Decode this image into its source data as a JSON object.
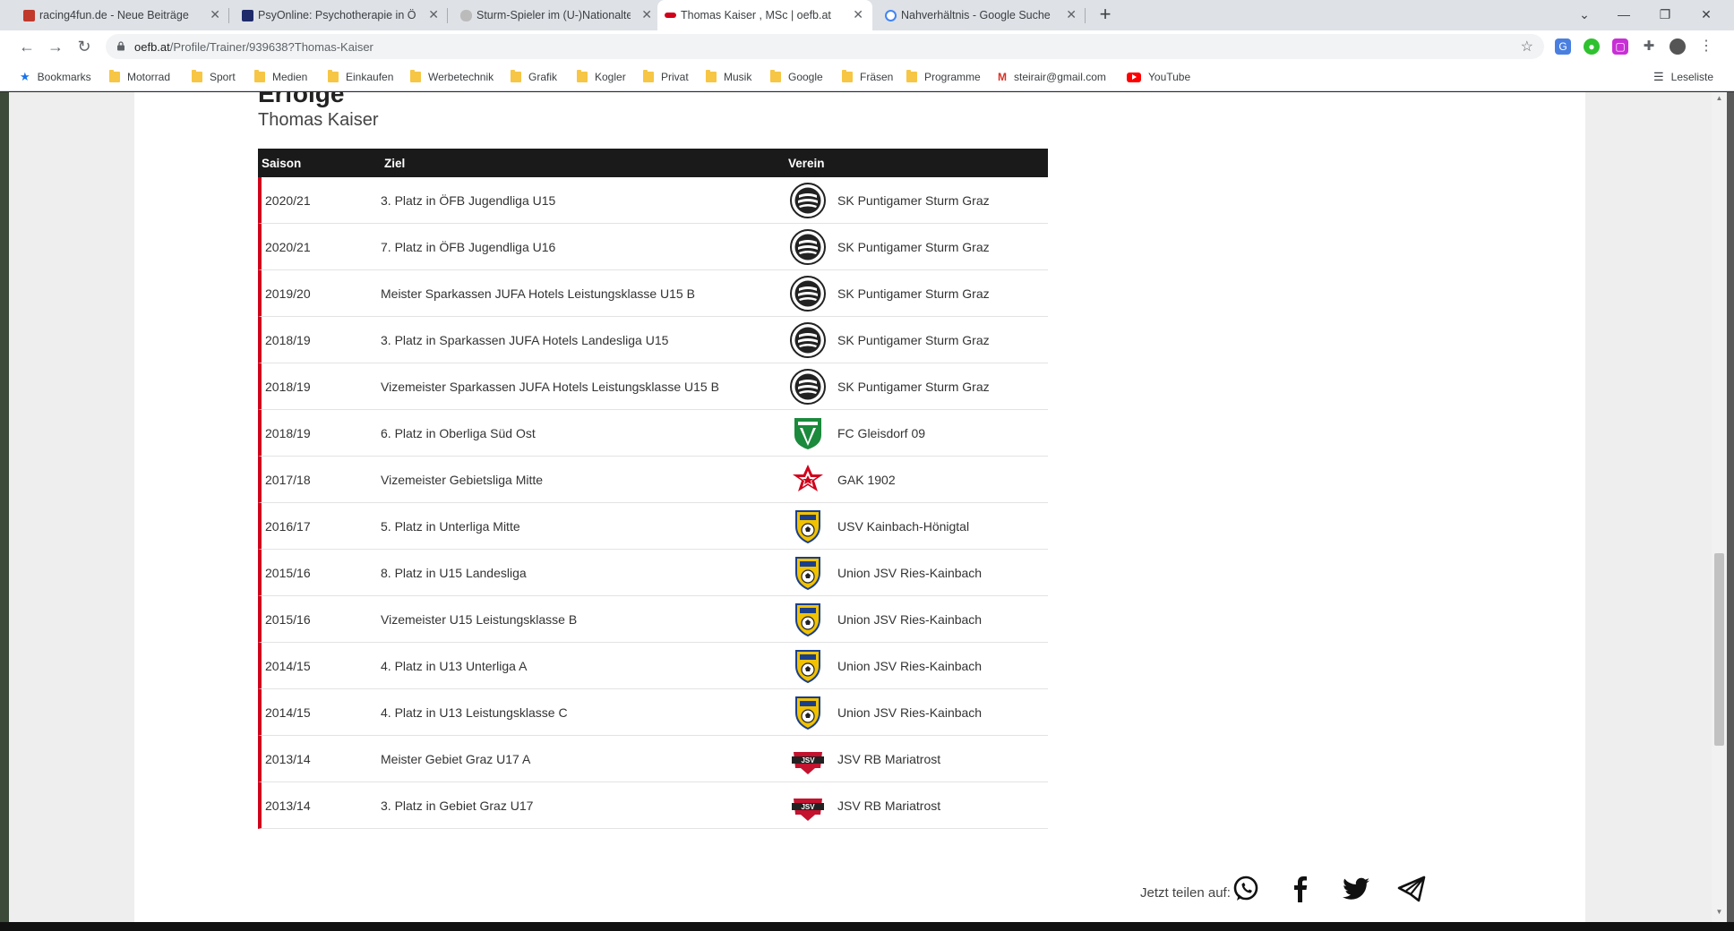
{
  "tabs": [
    {
      "label": "racing4fun.de - Neue Beiträge",
      "fav_color": "#c0392b"
    },
    {
      "label": "PsyOnline: Psychotherapie in Ö",
      "fav_color": "#1f2a6b"
    },
    {
      "label": "Sturm-Spieler im (U-)Nationaltea",
      "fav_color": "#8a8a8a"
    },
    {
      "label": "Thomas Kaiser , MSc | oefb.at",
      "fav_color": "#d0021b"
    },
    {
      "label": "Nahverhältnis - Google Suche",
      "fav_color": "#4285f4"
    }
  ],
  "address": {
    "host": "oefb.at",
    "path": "/Profile/Trainer/939638?Thomas-Kaiser"
  },
  "bookmarks": [
    {
      "label": "Bookmarks"
    },
    {
      "label": "Motorrad"
    },
    {
      "label": "Sport"
    },
    {
      "label": "Medien"
    },
    {
      "label": "Einkaufen"
    },
    {
      "label": "Werbetechnik"
    },
    {
      "label": "Grafik"
    },
    {
      "label": "Kogler"
    },
    {
      "label": "Privat"
    },
    {
      "label": "Musik"
    },
    {
      "label": "Google"
    },
    {
      "label": "Fräsen"
    },
    {
      "label": "Programme"
    },
    {
      "label": "steirair@gmail.com"
    },
    {
      "label": "YouTube"
    }
  ],
  "reading_list": "Leseliste",
  "page": {
    "heading": "Erfolge",
    "subheading": "Thomas Kaiser",
    "columns": {
      "season": "Saison",
      "goal": "Ziel",
      "club": "Verein"
    },
    "rows": [
      {
        "season": "2020/21",
        "goal": "3. Platz in ÖFB Jugendliga U15",
        "club": "SK Puntigamer Sturm Graz",
        "logo": "sturm"
      },
      {
        "season": "2020/21",
        "goal": "7. Platz in ÖFB Jugendliga U16",
        "club": "SK Puntigamer Sturm Graz",
        "logo": "sturm"
      },
      {
        "season": "2019/20",
        "goal": "Meister Sparkassen JUFA Hotels Leistungsklasse U15 B",
        "club": "SK Puntigamer Sturm Graz",
        "logo": "sturm"
      },
      {
        "season": "2018/19",
        "goal": "3. Platz in Sparkassen JUFA Hotels Landesliga U15",
        "club": "SK Puntigamer Sturm Graz",
        "logo": "sturm"
      },
      {
        "season": "2018/19",
        "goal": "Vizemeister Sparkassen JUFA Hotels Leistungsklasse U15 B",
        "club": "SK Puntigamer Sturm Graz",
        "logo": "sturm"
      },
      {
        "season": "2018/19",
        "goal": "6. Platz in Oberliga Süd Ost",
        "club": "FC Gleisdorf 09",
        "logo": "gleisdorf"
      },
      {
        "season": "2017/18",
        "goal": "Vizemeister Gebietsliga Mitte",
        "club": "GAK 1902",
        "logo": "gak"
      },
      {
        "season": "2016/17",
        "goal": "5. Platz in Unterliga Mitte",
        "club": "USV Kainbach-Hönigtal",
        "logo": "kainbach"
      },
      {
        "season": "2015/16",
        "goal": "8. Platz in U15 Landesliga",
        "club": "Union JSV Ries-Kainbach",
        "logo": "kainbach"
      },
      {
        "season": "2015/16",
        "goal": "Vizemeister U15 Leistungsklasse B",
        "club": "Union JSV Ries-Kainbach",
        "logo": "kainbach"
      },
      {
        "season": "2014/15",
        "goal": "4. Platz in U13 Unterliga A",
        "club": "Union JSV Ries-Kainbach",
        "logo": "kainbach"
      },
      {
        "season": "2014/15",
        "goal": "4. Platz in U13 Leistungsklasse C",
        "club": "Union JSV Ries-Kainbach",
        "logo": "kainbach"
      },
      {
        "season": "2013/14",
        "goal": "Meister Gebiet Graz U17 A",
        "club": "JSV RB Mariatrost",
        "logo": "mariatrost"
      },
      {
        "season": "2013/14",
        "goal": "3. Platz in Gebiet Graz U17",
        "club": "JSV RB Mariatrost",
        "logo": "mariatrost"
      }
    ],
    "share_label": "Jetzt teilen auf:",
    "share_targets": [
      "whatsapp-icon",
      "facebook-icon",
      "twitter-icon",
      "telegram-icon"
    ]
  }
}
